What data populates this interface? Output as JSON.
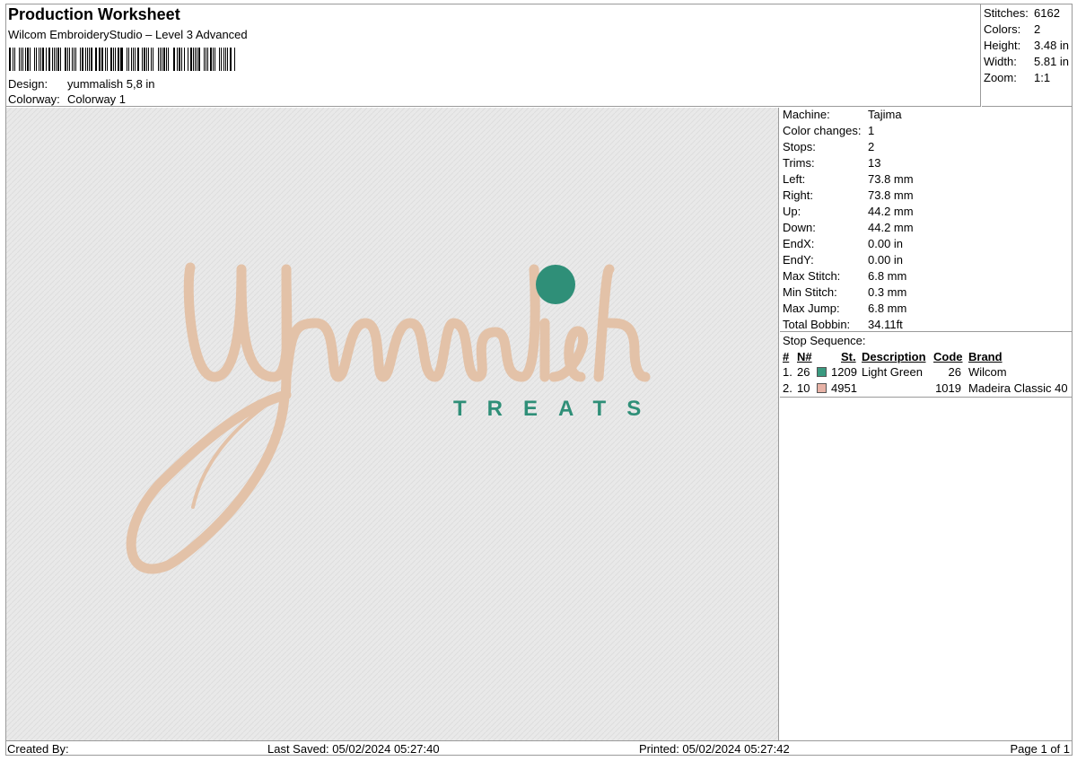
{
  "header": {
    "title": "Production Worksheet",
    "subtitle": "Wilcom EmbroideryStudio – Level 3 Advanced",
    "design_label": "Design:",
    "design_value": "yummalish 5,8 in",
    "colorway_label": "Colorway:",
    "colorway_value": "Colorway 1"
  },
  "summary": {
    "stitches_label": "Stitches:",
    "stitches": "6162",
    "colors_label": "Colors:",
    "colors": "2",
    "height_label": "Height:",
    "height": "3.48 in",
    "width_label": "Width:",
    "width": "5.81 in",
    "zoom_label": "Zoom:",
    "zoom": "1:1"
  },
  "machine": {
    "rows": [
      {
        "k": "Machine:",
        "v": "Tajima"
      },
      {
        "k": "Color changes:",
        "v": "1"
      },
      {
        "k": "Stops:",
        "v": "2"
      },
      {
        "k": "Trims:",
        "v": "13"
      },
      {
        "k": "Left:",
        "v": "73.8 mm"
      },
      {
        "k": "Right:",
        "v": "73.8 mm"
      },
      {
        "k": "Up:",
        "v": "44.2 mm"
      },
      {
        "k": "Down:",
        "v": "44.2 mm"
      },
      {
        "k": "EndX:",
        "v": "0.00 in"
      },
      {
        "k": "EndY:",
        "v": "0.00 in"
      },
      {
        "k": "Max Stitch:",
        "v": "6.8 mm"
      },
      {
        "k": "Min Stitch:",
        "v": "0.3 mm"
      },
      {
        "k": "Max Jump:",
        "v": "6.8 mm"
      },
      {
        "k": "Total Bobbin:",
        "v": "34.11ft"
      }
    ]
  },
  "stops": {
    "label": "Stop Sequence:",
    "headers": {
      "num": "#",
      "n": "N#",
      "st": "St.",
      "desc": "Description",
      "code": "Code",
      "brand": "Brand"
    },
    "rows": [
      {
        "num": "1.",
        "n": "26",
        "color": "#3a9a80",
        "st": "1209",
        "desc": "Light Green",
        "code": "26",
        "brand": "Wilcom"
      },
      {
        "num": "2.",
        "n": "10",
        "color": "#e7b2a6",
        "st": "4951",
        "desc": "",
        "code": "1019",
        "brand": "Madeira Classic 40"
      }
    ]
  },
  "design": {
    "script_text": "yummalish",
    "tagline": "TREATS",
    "script_color": "#e3c2a8",
    "accent_color": "#2f8f78"
  },
  "footer": {
    "created_by": "Created By:",
    "last_saved": "Last Saved: 05/02/2024 05:27:40",
    "printed": "Printed: 05/02/2024 05:27:42",
    "page": "Page 1 of 1"
  }
}
